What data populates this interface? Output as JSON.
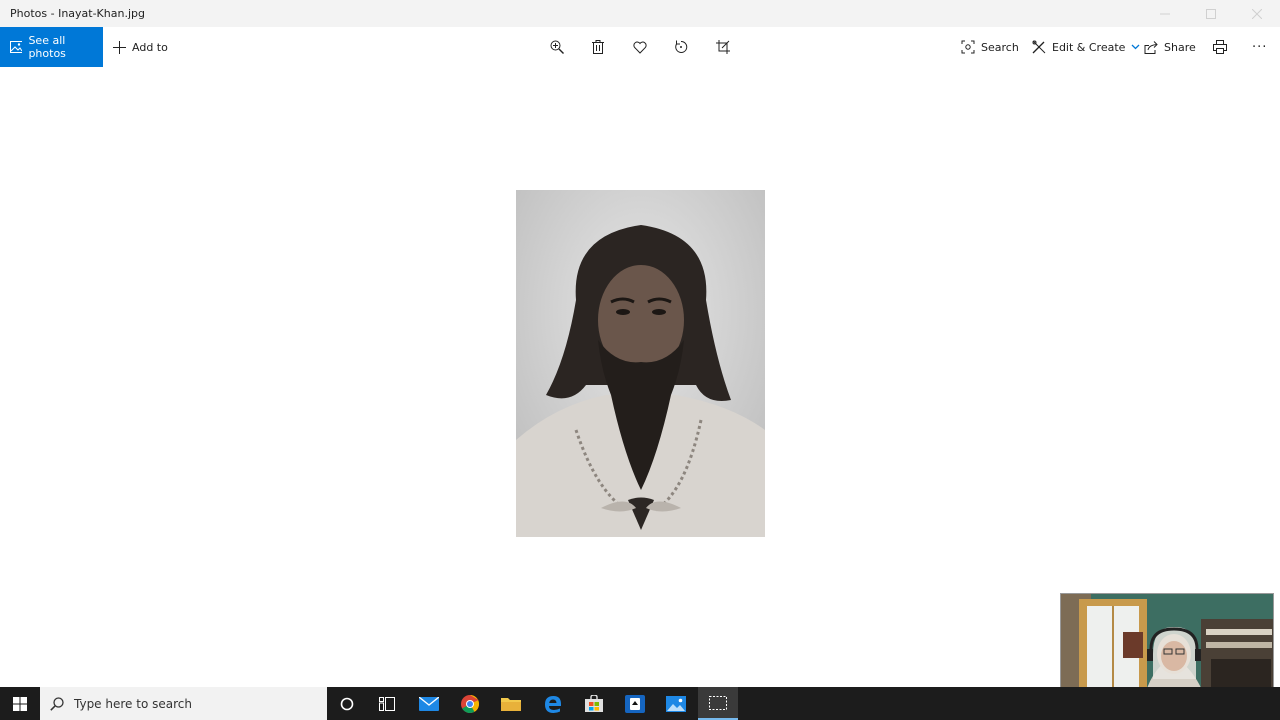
{
  "window": {
    "title": "Photos - Inayat-Khan.jpg"
  },
  "toolbar": {
    "see_all_photos": "See all photos",
    "add_to": "Add to",
    "search": "Search",
    "edit_create": "Edit & Create",
    "share": "Share",
    "more": "···"
  },
  "taskbar": {
    "search_placeholder": "Type here to search"
  },
  "colors": {
    "accent": "#0078d7",
    "taskbar": "#1c1c1c"
  },
  "icons": {
    "toolbar": [
      "zoom-icon",
      "delete-icon",
      "favorite-icon",
      "rotate-icon",
      "crop-icon",
      "print-icon"
    ],
    "taskbar": [
      "windows-start-icon",
      "search-icon",
      "cortana-icon",
      "task-view-icon",
      "mail-icon",
      "chrome-icon",
      "file-explorer-icon",
      "edge-icon",
      "store-icon",
      "solitaire-icon",
      "photos-icon",
      "snipping-tool-icon"
    ]
  }
}
